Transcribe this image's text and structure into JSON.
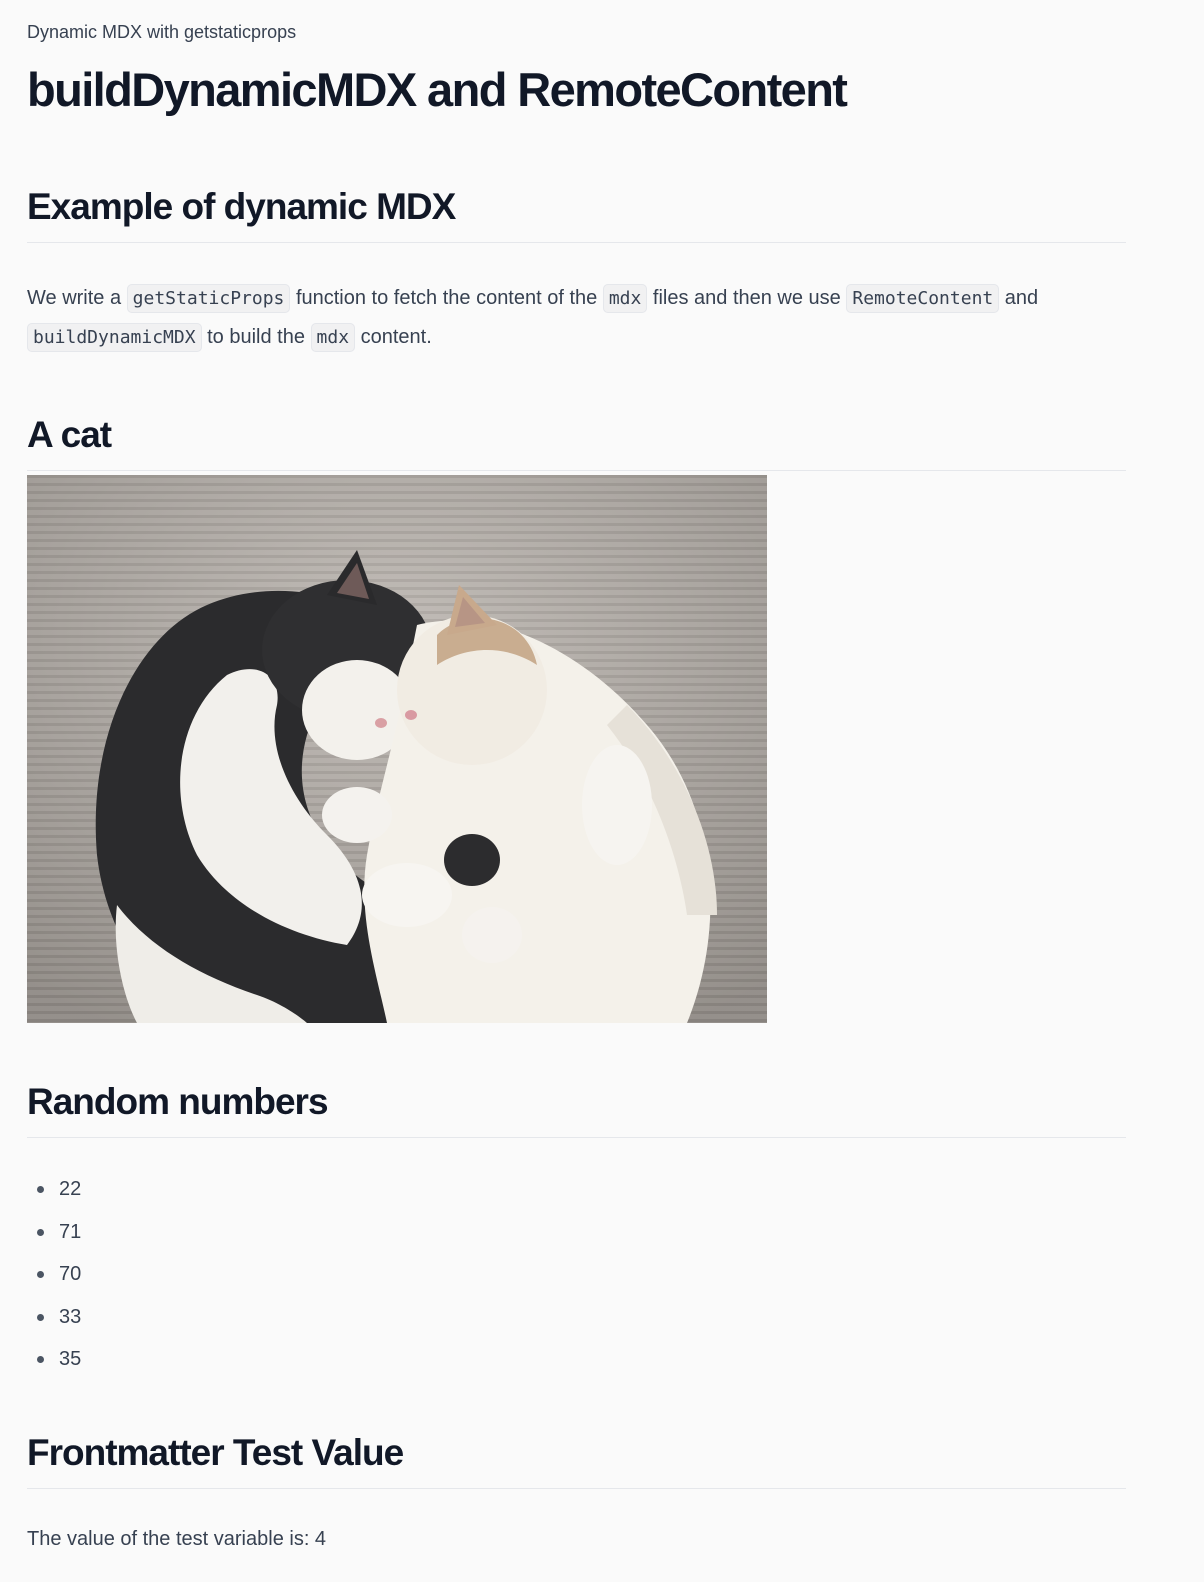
{
  "breadcrumb": "Dynamic MDX with getstaticprops",
  "title": "buildDynamicMDX and RemoteContent",
  "sections": {
    "example": {
      "heading": "Example of dynamic MDX",
      "text": {
        "t1": "We write a ",
        "c1": "getStaticProps",
        "t2": " function to fetch the content of the ",
        "c2": "mdx",
        "t3": " files and then we use ",
        "c3": "RemoteContent",
        "t4": " and ",
        "c4": "buildDynamicMDX",
        "t5": " to build the ",
        "c5": "mdx",
        "t6": " content."
      }
    },
    "cat": {
      "heading": "A cat",
      "image_icon": "cat-photo"
    },
    "random": {
      "heading": "Random numbers",
      "items": [
        "22",
        "71",
        "70",
        "33",
        "35"
      ]
    },
    "frontmatter": {
      "heading": "Frontmatter Test Value",
      "text": "The value of the test variable is: 4"
    }
  }
}
